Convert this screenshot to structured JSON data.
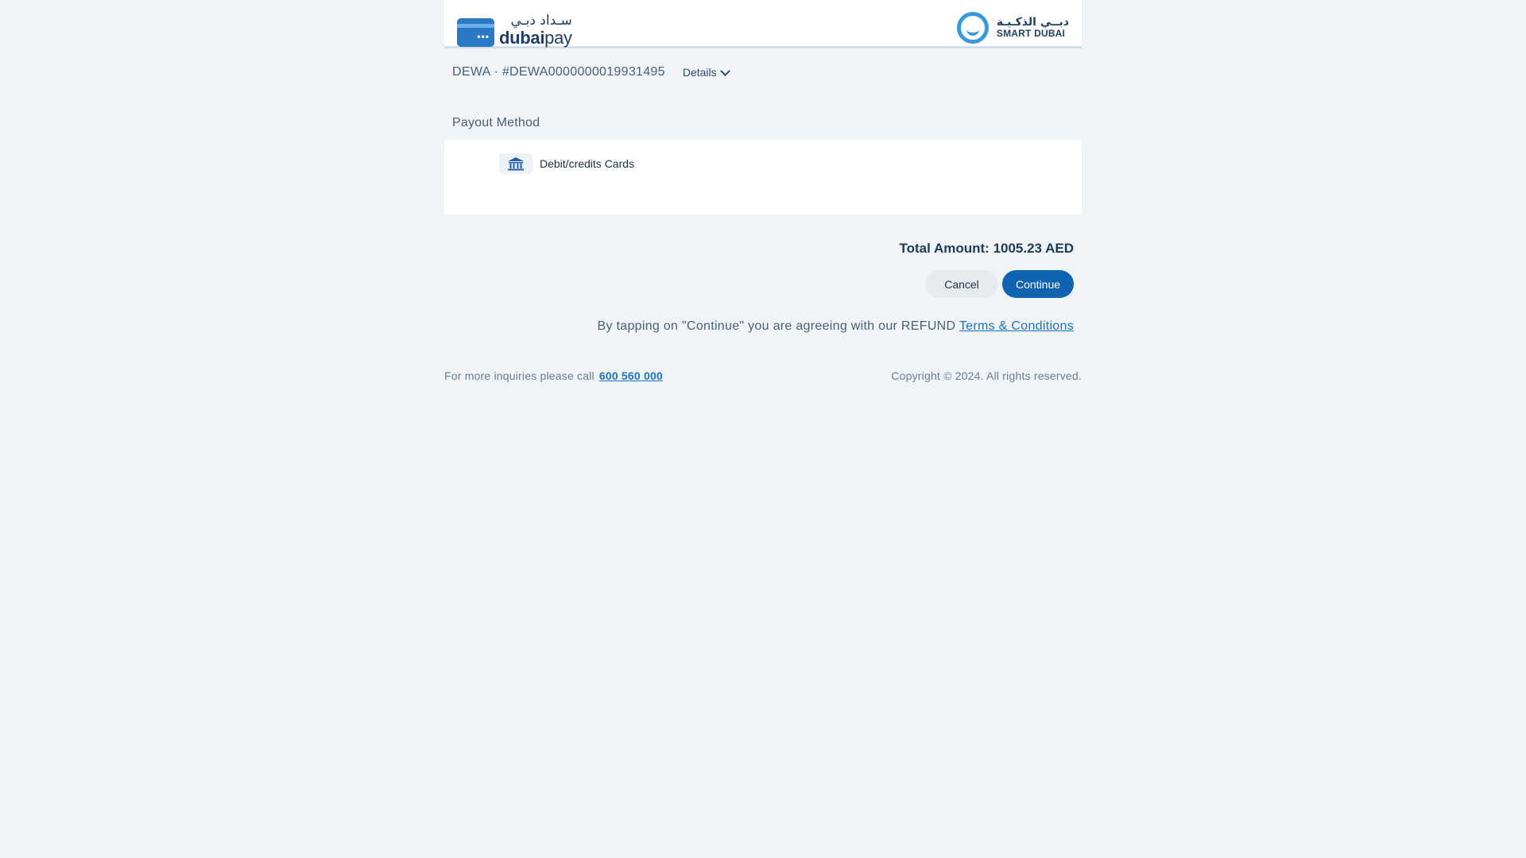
{
  "header": {
    "left_logo": {
      "arabic": "سـداد دبـي",
      "word_bold": "dubai",
      "word_regular": "pay",
      "card_dots": "•••"
    },
    "right_logo": {
      "arabic": "دبــي الذكـيـة",
      "english": "SMART DUBAI"
    }
  },
  "reference": {
    "text": "DEWA · #DEWA0000000019931495",
    "details_label": "Details"
  },
  "payout": {
    "title": "Payout Method",
    "methods": [
      {
        "label": "Debit/credits Cards",
        "icon": "bank-icon"
      }
    ]
  },
  "summary": {
    "total_label": "Total Amount:",
    "total_value": "1005.23 AED",
    "cancel_label": "Cancel",
    "continue_label": "Continue"
  },
  "agreement": {
    "text": "By tapping on \"Continue\" you are agreeing with our REFUND",
    "link_label": "Terms & Conditions"
  },
  "footer": {
    "inquiry_text": "For more inquiries please call",
    "phone": "600 560 000",
    "copyright": "Copyright © 2024. All rights reserved."
  },
  "colors": {
    "page_background": "#f0f4f7",
    "primary": "#0f63b2",
    "link": "#1a73c4",
    "heading": "#1e3a5a"
  }
}
